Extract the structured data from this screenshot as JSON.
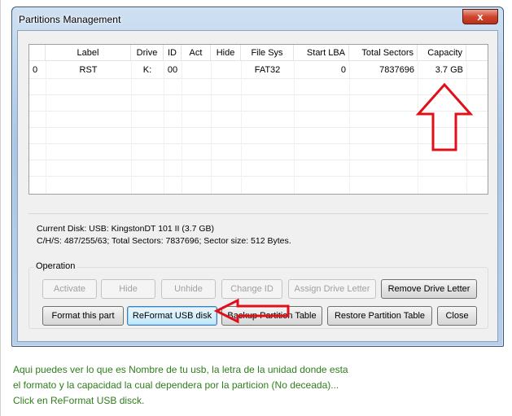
{
  "window": {
    "title": "Partitions Management",
    "close_glyph": "x"
  },
  "table": {
    "columns": [
      "Label",
      "Drive",
      "ID",
      "Act",
      "Hide",
      "File Sys",
      "Start LBA",
      "Total Sectors",
      "Capacity"
    ],
    "rows": [
      {
        "index": "0",
        "label": "RST",
        "drive": "K:",
        "id": "00",
        "act": "",
        "hide": "",
        "file_sys": "FAT32",
        "start_lba": "0",
        "total_sectors": "7837696",
        "capacity": "3.7 GB"
      }
    ]
  },
  "info": {
    "line1": "Current Disk:   USB: KingstonDT 101 II (3.7 GB)",
    "line2": "C/H/S: 487/255/63; Total Sectors: 7837696; Sector size: 512 Bytes."
  },
  "operation": {
    "legend": "Operation",
    "row1": {
      "activate": "Activate",
      "hide": "Hide",
      "unhide": "Unhide",
      "change_id": "Change ID",
      "assign_drive_letter": "Assign Drive Letter",
      "remove_drive_letter": "Remove Drive Letter"
    },
    "row2": {
      "format_this_part": "Format this part",
      "reformat_usb_disk": "ReFormat USB disk",
      "backup_partition_table": "Backup Partition Table",
      "restore_partition_table": "Restore Partition Table",
      "close": "Close"
    }
  },
  "caption": {
    "line1": "Aqui puedes ver lo que es Nombre de tu usb, la letra de la unidad donde esta",
    "line2": "el formato y la capacidad la cual dependera por la particion (No deceada)...",
    "line3": "Click en ReFormat USB disck."
  },
  "colors": {
    "annotation_red": "#e0101a",
    "caption_green": "#2f7d1c"
  }
}
